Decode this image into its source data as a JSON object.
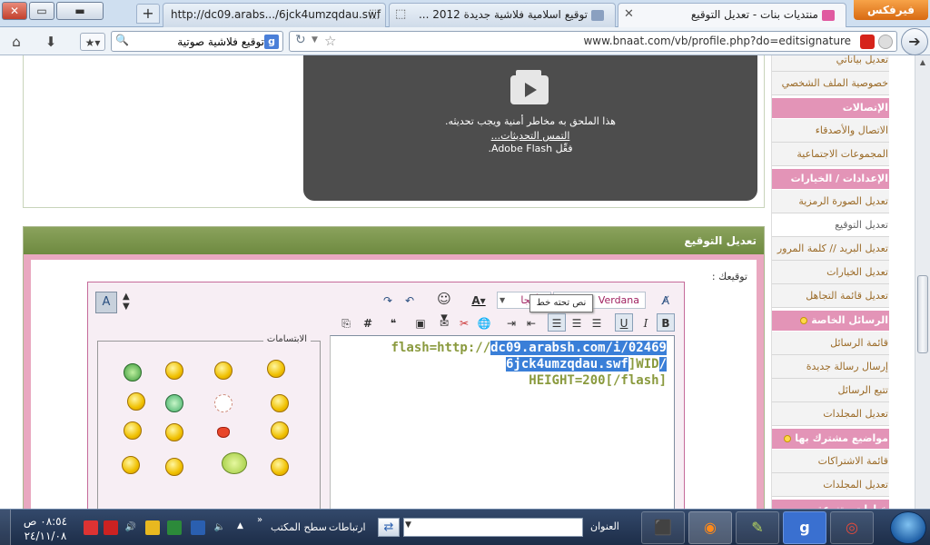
{
  "window": {
    "firefox_menu": "فيرفكس",
    "close": "✕",
    "restore": "▭",
    "minimize": "▬"
  },
  "tabs": [
    {
      "label": "http://dc09.arabs.../6jck4umzqdau.swf"
    },
    {
      "label": "توقيع اسلامية فلاشية جديدة 2012 ..."
    },
    {
      "label": "منتديات بنات - تعديل التوقيع"
    }
  ],
  "navbar": {
    "search_value": "توقيع فلاشية صوتية",
    "search_engine": "g",
    "url": "www.bnaat.com/vb/profile.php?do=editsignature"
  },
  "flash": {
    "message": "هذا الملحق به مخاطر أمنية ويجب تحديثه.",
    "update_link": "التمس التحديثات...",
    "enable": "فعِّل Adobe Flash."
  },
  "signature": {
    "header": "تعديل التوقيع",
    "label": "توقيعك :",
    "font_name": "Verdana",
    "font_size": "الأحجا",
    "text_line1a": "flash=http://",
    "text_line1b": "dc09.arabsh.com/i/02469",
    "text_line2a": "/6jck4umzqdau.swf",
    "text_line2b": "]WID",
    "text_line3": "[HEIGHT=200[/flash",
    "tooltip": "نص تحته خط",
    "smilies_title": "الابتسامات"
  },
  "sidebar": {
    "items": [
      {
        "label": "تعديل بياناتي",
        "type": "item"
      },
      {
        "label": "خصوصية الملف الشخصي",
        "type": "item"
      },
      {
        "label": "الإتصالات",
        "type": "head"
      },
      {
        "label": "الاتصال والأصدقاء",
        "type": "item"
      },
      {
        "label": "المجموعات الاجتماعية",
        "type": "item"
      },
      {
        "label": "الإعدادات / الخيارات",
        "type": "head"
      },
      {
        "label": "تعديل الصورة الرمزية",
        "type": "item"
      },
      {
        "label": "تعديل التوقيع",
        "type": "current"
      },
      {
        "label": "تعديل البريد // كلمة المرور",
        "type": "item"
      },
      {
        "label": "تعديل الخيارات",
        "type": "item"
      },
      {
        "label": "تعديل قائمة التجاهل",
        "type": "item"
      },
      {
        "label": "الرسائل الخاصة",
        "type": "head"
      },
      {
        "label": "قائمة الرسائل",
        "type": "item"
      },
      {
        "label": "إرسال رسالة جديدة",
        "type": "item"
      },
      {
        "label": "تتبع الرسائل",
        "type": "item"
      },
      {
        "label": "تعديل المجلدات",
        "type": "item"
      },
      {
        "label": "مواضيع مشترك بها",
        "type": "head"
      },
      {
        "label": "قائمة الاشتراكات",
        "type": "item"
      },
      {
        "label": "تعديل المجلدات",
        "type": "item"
      },
      {
        "label": "خيارات متنوعة",
        "type": "head"
      }
    ]
  },
  "taskbar": {
    "address_label": "العنوان",
    "links_label": "ارتباطات",
    "desktop_label": "سطح المكتب",
    "more": "»",
    "time": "٠٨:٥٤ ص",
    "date": "٢٤/١١/٠٨",
    "google_app": "g"
  },
  "colors": {
    "sidebar_head": "#e394b7",
    "sig_header": "#7a9448",
    "editor_border": "#c56b9a"
  }
}
